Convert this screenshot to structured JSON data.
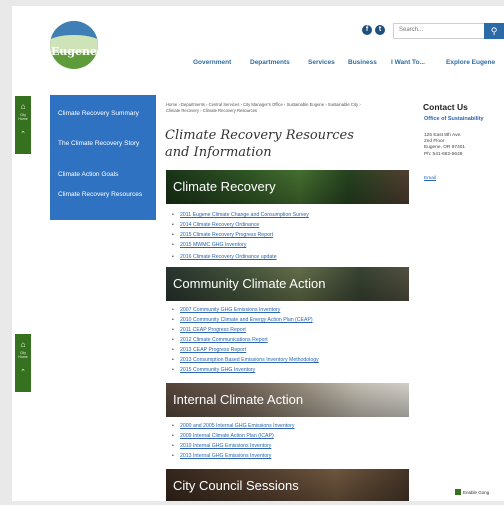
{
  "header": {
    "logo_text": "Eugene",
    "social": [
      "f",
      "t"
    ],
    "search_placeholder": "Search...",
    "search_icon": "search-icon",
    "nav": [
      "Government",
      "Departments",
      "Services",
      "Business",
      "I Want To...",
      "Explore Eugene"
    ]
  },
  "floating_tabs": [
    {
      "label": "City Home",
      "icon": "home-icon",
      "arrow": "chevron-up-icon"
    },
    {
      "label": "City Home",
      "icon": "home-icon",
      "arrow": "chevron-up-icon"
    }
  ],
  "subnav": {
    "items": [
      "Climate Recovery Summary",
      "The Climate Recovery Story",
      "Climate Action Goals",
      "Climate Recovery Resources"
    ]
  },
  "breadcrumb": "Home › Departments › Central Services › City Manager's Office › Sustainable Eugene › Sustainable City › Climate Recovery › Climate Recovery Resources",
  "page_title": "Climate Recovery Resources and Information",
  "sections": [
    {
      "title": "Climate Recovery",
      "links": [
        "2011 Eugene Climate Change and Consumption Survey",
        "2014 Climate Recovery Ordinance",
        "2015 Climate Recovery Progress Report",
        "2015 MWMC GHG Inventory",
        "2016 Climate Recovery Ordinance update"
      ]
    },
    {
      "title": "Community Climate Action",
      "links": [
        "2007 Community GHG Emissions Inventory",
        "2010 Community Climate and Energy Action Plan (CEAP)",
        "2011 CEAP Progress Report",
        "2012 Climate Communications Report",
        "2013 CEAP Progress Report",
        "2013 Consumption Based Emissions Inventory Methodology",
        "2015 Community GHG Inventory"
      ]
    },
    {
      "title": "Internal Climate Action",
      "links": [
        "2000 and 2005 Internal GHG Emissions Inventory",
        "2009 Internal Climate Action Plan (ICAP)",
        "2010 Internal GHG Emissions Inventory",
        "2013 Internal GHG Emissions Inventory"
      ]
    },
    {
      "title": "City Council Sessions",
      "links": []
    }
  ],
  "contact": {
    "title": "Contact Us",
    "office": "Office of Sustainability",
    "address": [
      "125 East 8th Ave.",
      "2nd Floor",
      "Eugene, OR 97401",
      "Ph: 541-682-5649"
    ],
    "email": "Email"
  },
  "gong": {
    "label": "Enable Gong"
  }
}
